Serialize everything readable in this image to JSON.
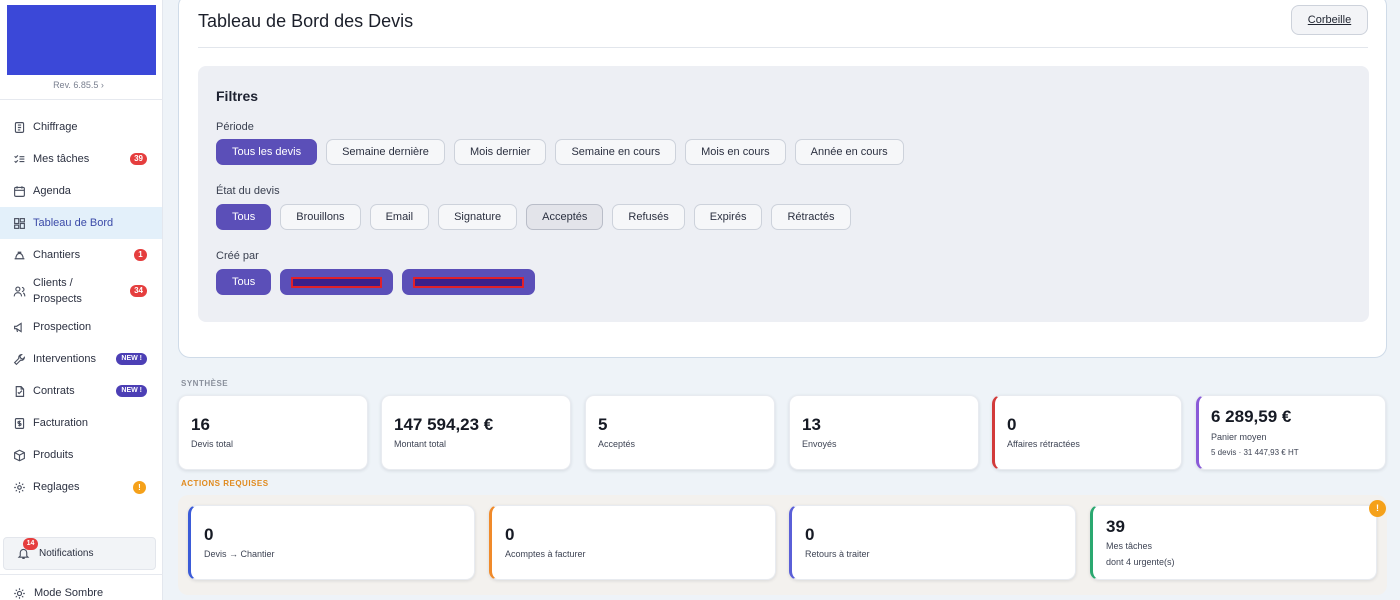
{
  "sidebar": {
    "revision": "Rev. 6.85.5 ›",
    "items": [
      {
        "label": "Chiffrage",
        "icon": "clipboard-icon"
      },
      {
        "label": "Mes tâches",
        "icon": "checklist-icon",
        "badge": "39"
      },
      {
        "label": "Agenda",
        "icon": "calendar-icon"
      },
      {
        "label": "Tableau de Bord",
        "icon": "dashboard-icon",
        "active": true
      },
      {
        "label": "Chantiers",
        "icon": "hardhat-icon",
        "badge": "1"
      },
      {
        "label": "Clients / Prospects",
        "icon": "users-icon",
        "badge": "34"
      },
      {
        "label": "Prospection",
        "icon": "megaphone-icon"
      },
      {
        "label": "Interventions",
        "icon": "wrench-icon",
        "badge": "NEW !"
      },
      {
        "label": "Contrats",
        "icon": "contract-icon",
        "badge": "NEW !"
      },
      {
        "label": "Facturation",
        "icon": "invoice-icon"
      },
      {
        "label": "Produits",
        "icon": "box-icon"
      },
      {
        "label": "Reglages",
        "icon": "gear-icon",
        "badge": "!"
      }
    ],
    "notifications": {
      "label": "Notifications",
      "count": "14"
    },
    "mode_label": "Mode Sombre"
  },
  "header": {
    "title": "Tableau de Bord des Devis",
    "corbeille_label": "Corbeille"
  },
  "filters": {
    "title": "Filtres",
    "periode": {
      "label": "Période",
      "options": [
        "Tous les devis",
        "Semaine dernière",
        "Mois dernier",
        "Semaine en cours",
        "Mois en cours",
        "Année en cours"
      ],
      "selected": "Tous les devis"
    },
    "etat": {
      "label": "État du devis",
      "options": [
        "Tous",
        "Brouillons",
        "Email",
        "Signature",
        "Acceptés",
        "Refusés",
        "Expirés",
        "Rétractés"
      ],
      "selected": "Tous"
    },
    "cree_par": {
      "label": "Créé par",
      "options": [
        "Tous"
      ],
      "selected": "Tous"
    }
  },
  "synthese": {
    "label": "SYNTHÈSE",
    "cards": [
      {
        "value": "16",
        "label": "Devis total"
      },
      {
        "value": "147 594,23 €",
        "label": "Montant total"
      },
      {
        "value": "5",
        "label": "Acceptés"
      },
      {
        "value": "13",
        "label": "Envoyés"
      },
      {
        "value": "0",
        "label": "Affaires rétractées"
      },
      {
        "value": "6 289,59 €",
        "label": "Panier moyen",
        "sub": "5 devis · 31 447,93 € HT"
      }
    ]
  },
  "actions": {
    "label": "ACTIONS REQUISES",
    "cards": [
      {
        "value": "0",
        "label": "Devis → Chantier"
      },
      {
        "value": "0",
        "label": "Acomptes à facturer"
      },
      {
        "value": "0",
        "label": "Retours à traiter"
      },
      {
        "value": "39",
        "label": "Mes tâches",
        "sub": "dont 4 urgente(s)",
        "alert": "!"
      }
    ]
  },
  "colors": {
    "accent": "#5b4fb8",
    "badge_red": "#e53e3e",
    "badge_new": "#4c3fb5",
    "warning": "#f5a11a",
    "active_nav_bg": "#e3f0fa"
  }
}
